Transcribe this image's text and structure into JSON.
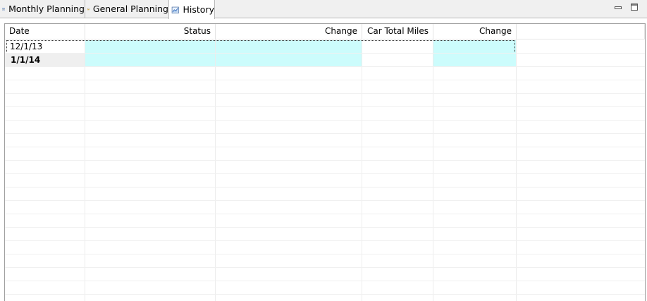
{
  "tabs": [
    {
      "label": "Monthly Planning",
      "icon": "calendar-icon"
    },
    {
      "label": "General Planning",
      "icon": "folder-icon"
    },
    {
      "label": "History",
      "icon": "chart-icon"
    }
  ],
  "active_tab": "History",
  "table": {
    "columns": [
      "Date",
      "Status",
      "Change",
      "Car Total Miles",
      "Change"
    ],
    "rows": [
      {
        "date": "12/1/13",
        "status": "",
        "change": "",
        "car_total_miles": "",
        "change2": ""
      },
      {
        "date": "1/1/14",
        "status": "",
        "change": "",
        "car_total_miles": "",
        "change2": ""
      }
    ]
  },
  "colors": {
    "highlight_cell": "#ccfcfc"
  }
}
